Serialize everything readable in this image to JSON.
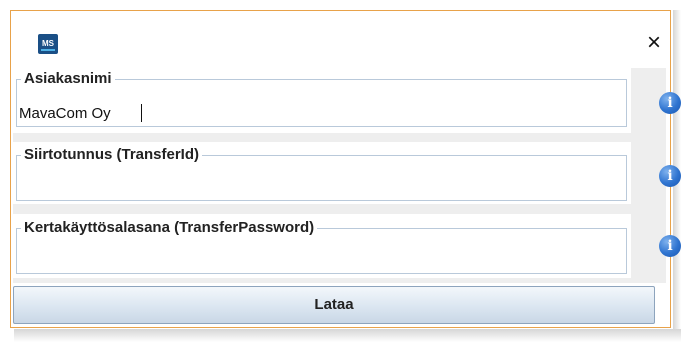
{
  "window": {
    "app_icon_text": "MS",
    "close_glyph": "×"
  },
  "fields": [
    {
      "label": "Asiakasnimi",
      "value": "MavaCom Oy",
      "placeholder": ""
    },
    {
      "label": "Siirtotunnus (TransferId)",
      "value": "",
      "placeholder": ""
    },
    {
      "label": "Kertakäyttösalasana (TransferPassword)",
      "value": "",
      "placeholder": ""
    }
  ],
  "info_glyph": "i",
  "submit_label": "Lataa",
  "colors": {
    "window_border": "#e8a24a",
    "field_border": "#b9c9da",
    "info_icon": "#2f74d0",
    "button_border": "#8da4bd"
  }
}
